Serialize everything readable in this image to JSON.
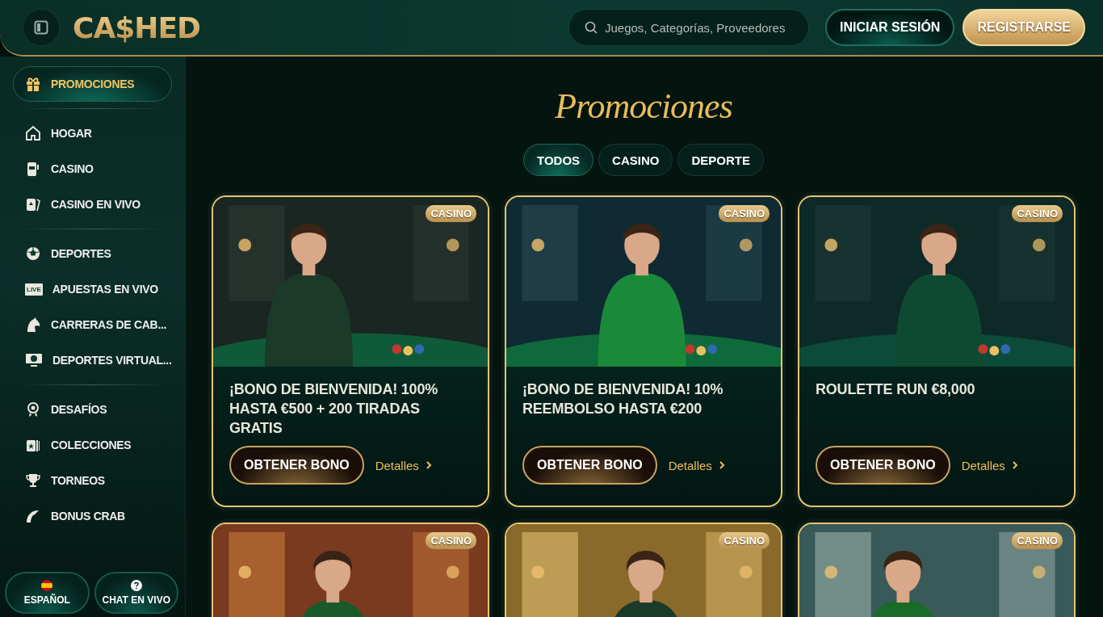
{
  "header": {
    "logo": "CA$HED",
    "search": {
      "placeholder": "Juegos, Categorías, Proveedores"
    },
    "buttons": [
      {
        "kind": "login",
        "label": "INICIAR SESIÓN"
      },
      {
        "kind": "register",
        "label": "REGISTRARSE"
      }
    ]
  },
  "sidebar": {
    "sections": [
      {
        "items": [
          {
            "label": "PROMOCIONES",
            "selected": true
          }
        ]
      },
      {
        "items": [
          {
            "label": "HOGAR",
            "selected": false
          },
          {
            "label": "CASINO",
            "selected": false
          },
          {
            "label": "CASINO EN VIVO",
            "selected": false
          }
        ]
      },
      {
        "items": [
          {
            "label": "DEPORTES",
            "selected": false
          },
          {
            "label": "APUESTAS EN VIVO",
            "selected": false,
            "tag": "LIVE"
          },
          {
            "label": "CARRERAS DE CAB...",
            "selected": false
          },
          {
            "label": "DEPORTES VIRTUAL...",
            "selected": false
          }
        ]
      },
      {
        "items": [
          {
            "label": "DESAFÍOS",
            "selected": false
          },
          {
            "label": "COLECCIONES",
            "selected": false
          },
          {
            "label": "TORNEOS",
            "selected": false
          },
          {
            "label": "BONUS CRAB",
            "selected": false
          }
        ]
      }
    ],
    "footer": [
      {
        "kind": "language",
        "label": "ESPAÑOL"
      },
      {
        "kind": "chat",
        "label": "CHAT EN VIVO"
      }
    ]
  },
  "main": {
    "title": "Promociones",
    "tabs": [
      {
        "label": "TODOS",
        "selected": true
      },
      {
        "label": "CASINO",
        "selected": false
      },
      {
        "label": "DEPORTE",
        "selected": false
      }
    ],
    "promos": [
      {
        "badge": "CASINO",
        "title": "¡BONO DE BIENVENIDA! 100% HASTA €500 + 200 TIRADAS GRATIS",
        "button": "OBTENER BONO",
        "details": "Detalles"
      },
      {
        "badge": "CASINO",
        "title": "¡BONO DE BIENVENIDA! 10% REEMBOLSO HASTA €200",
        "button": "OBTENER BONO",
        "details": "Detalles"
      },
      {
        "badge": "CASINO",
        "title": "ROULETTE RUN €8,000",
        "button": "OBTENER BONO",
        "details": "Detalles"
      },
      {
        "badge": "CASINO"
      },
      {
        "badge": "CASINO"
      },
      {
        "badge": "CASINO"
      }
    ]
  }
}
